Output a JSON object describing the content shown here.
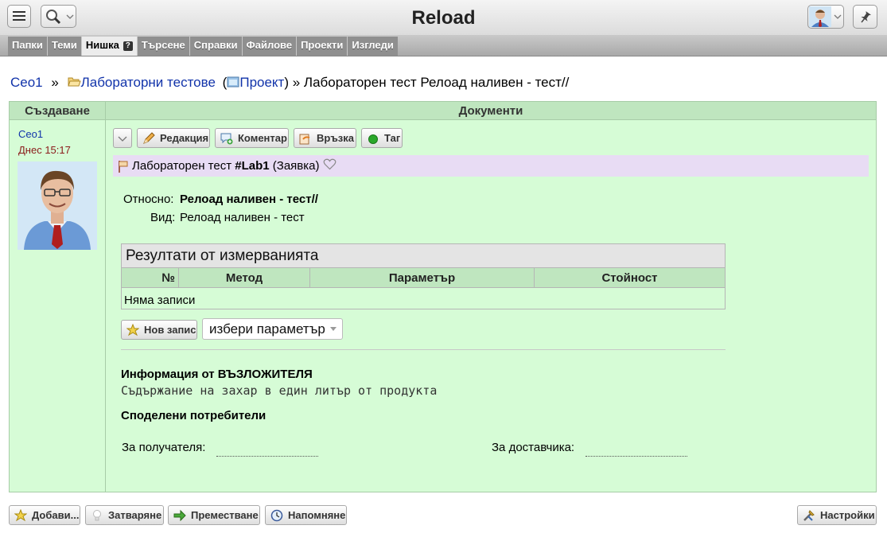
{
  "app": {
    "title": "Reload"
  },
  "toolbar": {
    "menu_icon": "menu-icon",
    "search_icon": "search-icon",
    "user_icon": "user-avatar-icon",
    "pin_icon": "pin-icon"
  },
  "tabs": [
    {
      "label": "Папки"
    },
    {
      "label": "Теми"
    },
    {
      "label": "Нишка",
      "help": "?"
    },
    {
      "label": "Търсене"
    },
    {
      "label": "Справки"
    },
    {
      "label": "Файлове"
    },
    {
      "label": "Проекти"
    },
    {
      "label": "Изгледи"
    }
  ],
  "breadcrumb": {
    "root": "Ceo1",
    "sep": "»",
    "folder": "Лабораторни тестове",
    "open_paren": "(",
    "project": "Проект",
    "close_sep": ") »",
    "current": "Лабораторен тест Релоад наливен - тест//"
  },
  "table": {
    "col_create": "Създаване",
    "col_docs": "Документи"
  },
  "author": {
    "name": "Ceo1",
    "time": "Днес 15:17"
  },
  "doc_toolbar": {
    "edit": "Редакция",
    "comment": "Коментар",
    "link": "Връзка",
    "tag": "Таг"
  },
  "doc": {
    "title_prefix": "Лабораторен тест",
    "handle": "#Lab1",
    "kind": "(Заявка)",
    "regarding_label": "Относно:",
    "regarding_value": "Релоад наливен - тест//",
    "type_label": "Вид:",
    "type_value": "Релоад наливен - тест"
  },
  "measurements": {
    "caption": "Резултати от измерванията",
    "columns": [
      "№",
      "Метод",
      "Параметър",
      "Стойност"
    ],
    "empty": "Няма записи",
    "new_button": "Нов запис",
    "select_placeholder": "избери параметър"
  },
  "client_info": {
    "heading": "Информация от ВЪЗЛОЖИТЕЛЯ",
    "text": "Съдържание на захар в един литър от продукта"
  },
  "shared": {
    "heading": "Споделени потребители",
    "recipient_label": "За получателя:",
    "supplier_label": "За доставчика:"
  },
  "footer": {
    "add": "Добави...",
    "close": "Затваряне",
    "move": "Преместване",
    "remind": "Напомняне",
    "settings": "Настройки"
  },
  "colors": {
    "frame_bg": "#d6fcd6",
    "header_bg": "#bfe6bf",
    "title_bg": "#e8dcf4",
    "link": "#1133aa"
  }
}
